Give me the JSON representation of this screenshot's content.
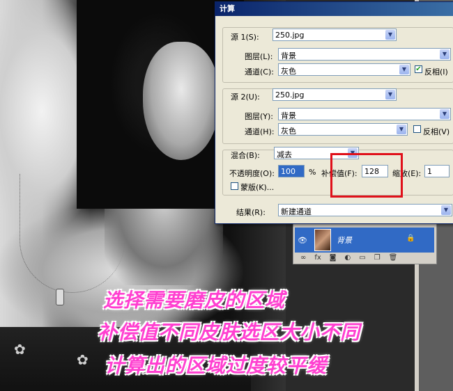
{
  "dialog": {
    "title": "计算",
    "source1": {
      "label": "源 1(S):",
      "file": "250.jpg",
      "layer_label": "图层(L):",
      "layer": "背景",
      "channel_label": "通道(C):",
      "channel": "灰色",
      "invert_label": "反相(I)",
      "invert_checked": true
    },
    "source2": {
      "label": "源 2(U):",
      "file": "250.jpg",
      "layer_label": "图层(Y):",
      "layer": "背景",
      "channel_label": "通道(H):",
      "channel": "灰色",
      "invert_label": "反相(V)",
      "invert_checked": false
    },
    "blend": {
      "label": "混合(B):",
      "mode": "减去",
      "opacity_label": "不透明度(O):",
      "opacity": "100",
      "percent": "%",
      "offset_label": "补偿值(F):",
      "offset": "128",
      "scale_label": "缩放(E):",
      "scale": "1",
      "mask_label": "蒙版(K)..."
    },
    "result": {
      "label": "结果(R):",
      "value": "新建通道"
    }
  },
  "layers_panel": {
    "layer_name": "背景",
    "eye_icon": "eye-icon",
    "lock_icon": "lock-icon"
  },
  "captions": [
    "选择需要磨皮的区域",
    "补偿值不同皮肤选区大小不同",
    "计算出的区域过度较平缓"
  ],
  "colors": {
    "caption": "#ff3fd0",
    "highlight_box": "#e0101a",
    "title_bar": "#0a246a"
  }
}
